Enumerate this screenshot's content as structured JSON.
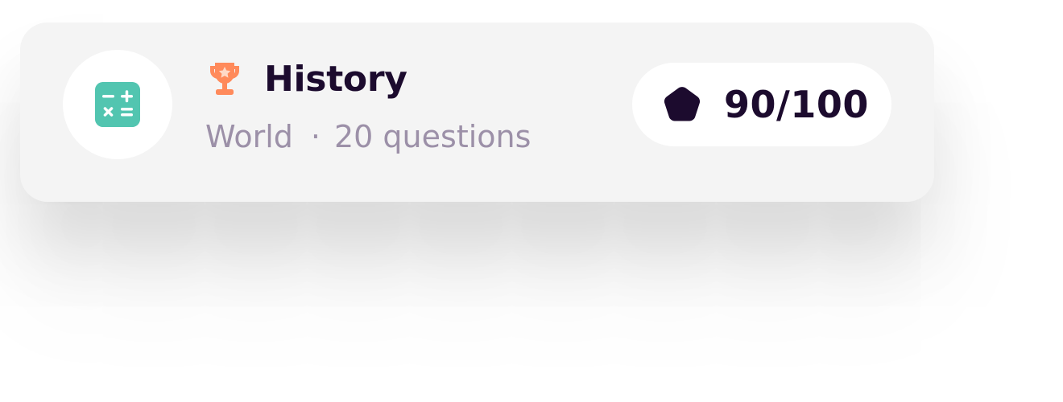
{
  "quiz_card": {
    "icon": "calculator-icon",
    "badge_icon": "trophy-icon",
    "title": "History",
    "category": "World",
    "separator": "·",
    "question_count": "20 questions",
    "score_icon": "gem-icon",
    "score": "90/100"
  },
  "colors": {
    "card_background": "#f4f4f4",
    "calculator_icon": "#52c5b0",
    "trophy_icon": "#ff8a5b",
    "title_text": "#1c0b2e",
    "meta_text": "#9c90a8",
    "gem_icon": "#1c0b2e"
  }
}
